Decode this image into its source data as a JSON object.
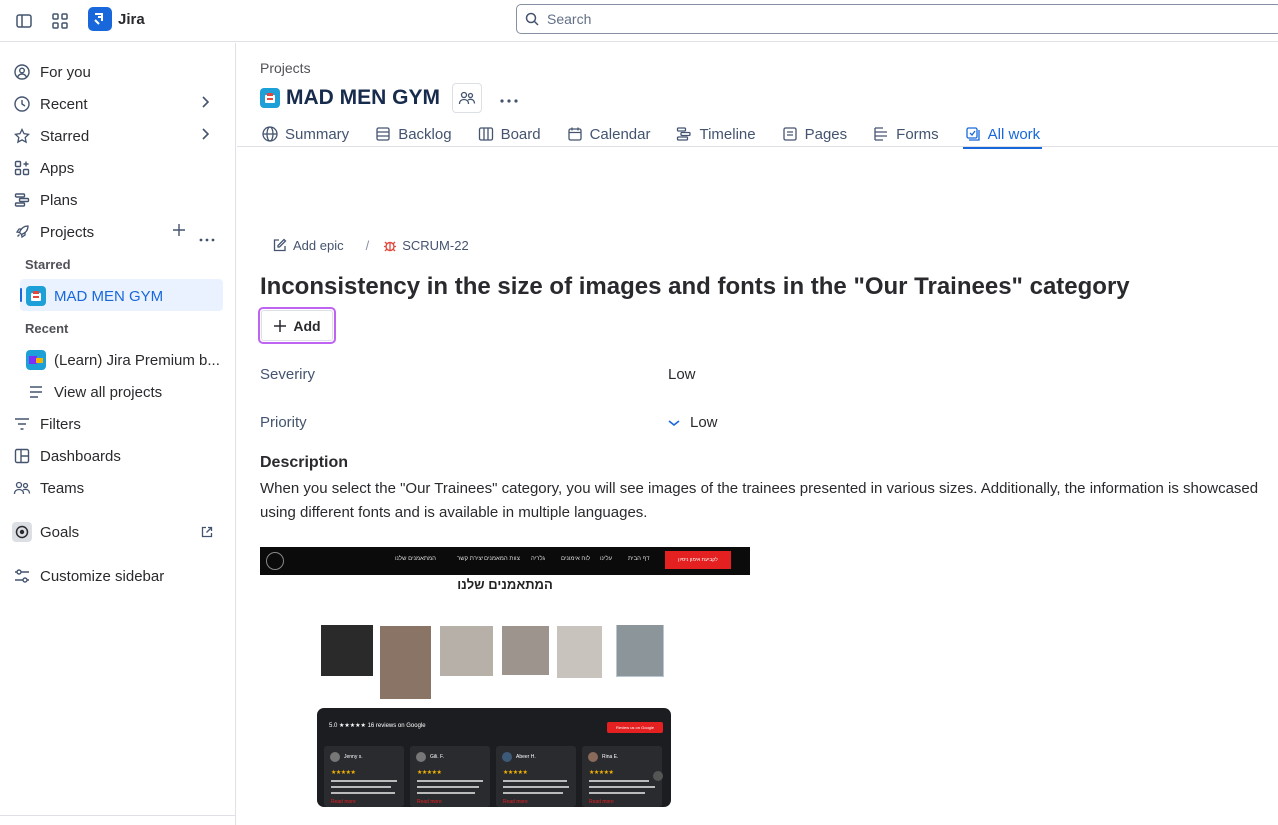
{
  "topbar": {
    "app_name": "Jira",
    "search_placeholder": "Search"
  },
  "sidebar": {
    "for_you": "For you",
    "recent": "Recent",
    "starred": "Starred",
    "apps": "Apps",
    "plans": "Plans",
    "projects": "Projects",
    "starred_heading": "Starred",
    "starred_project": "MAD MEN GYM",
    "recent_heading": "Recent",
    "recent_project": "(Learn) Jira Premium b...",
    "view_all_projects": "View all projects",
    "filters": "Filters",
    "dashboards": "Dashboards",
    "teams": "Teams",
    "goals": "Goals",
    "customize": "Customize sidebar"
  },
  "header": {
    "breadcrumb": "Projects",
    "project_title": "MAD MEN GYM",
    "tabs": [
      {
        "label": "Summary"
      },
      {
        "label": "Backlog"
      },
      {
        "label": "Board"
      },
      {
        "label": "Calendar"
      },
      {
        "label": "Timeline"
      },
      {
        "label": "Pages"
      },
      {
        "label": "Forms"
      },
      {
        "label": "All work"
      }
    ],
    "active_tab": "All work"
  },
  "issue": {
    "add_epic": "Add epic",
    "separator": "/",
    "key": "SCRUM-22",
    "title": "Inconsistency in the size of images and fonts in the \"Our Trainees\" category",
    "add_button": "Add",
    "fields": [
      {
        "label": "Severiry",
        "value": "Low"
      },
      {
        "label": "Priority",
        "value": "Low"
      }
    ],
    "description_heading": "Description",
    "description": "When you select the \"Our Trainees\" category, you will see images of the trainees presented in various sizes. Additionally, the information is showcased using different fonts and is available in multiple languages."
  },
  "attachment": {
    "heading": "המתאמנים שלנו",
    "nav_items": [
      "דף הבית",
      "עלינו",
      "לוח אימונים",
      "גלריה",
      "צוות המאמנים",
      "יצירת קשר",
      "המתאמנים שלנו"
    ],
    "cta": "לקביעת אימון ניסיון",
    "rating_text": "5.0 ★★★★★ 16 reviews on Google",
    "review_button": "Review us on Google",
    "reviewers": [
      "Jenny s.",
      "Gili. F.",
      "Abeer H.",
      "Rina E."
    ],
    "read_more": "Read more"
  },
  "colors": {
    "accent": "#1868db",
    "selected_bg": "#e9f2fe",
    "add_focus": "#bf63f3",
    "bug_red": "#e2483d",
    "cta_red": "#e52020"
  }
}
